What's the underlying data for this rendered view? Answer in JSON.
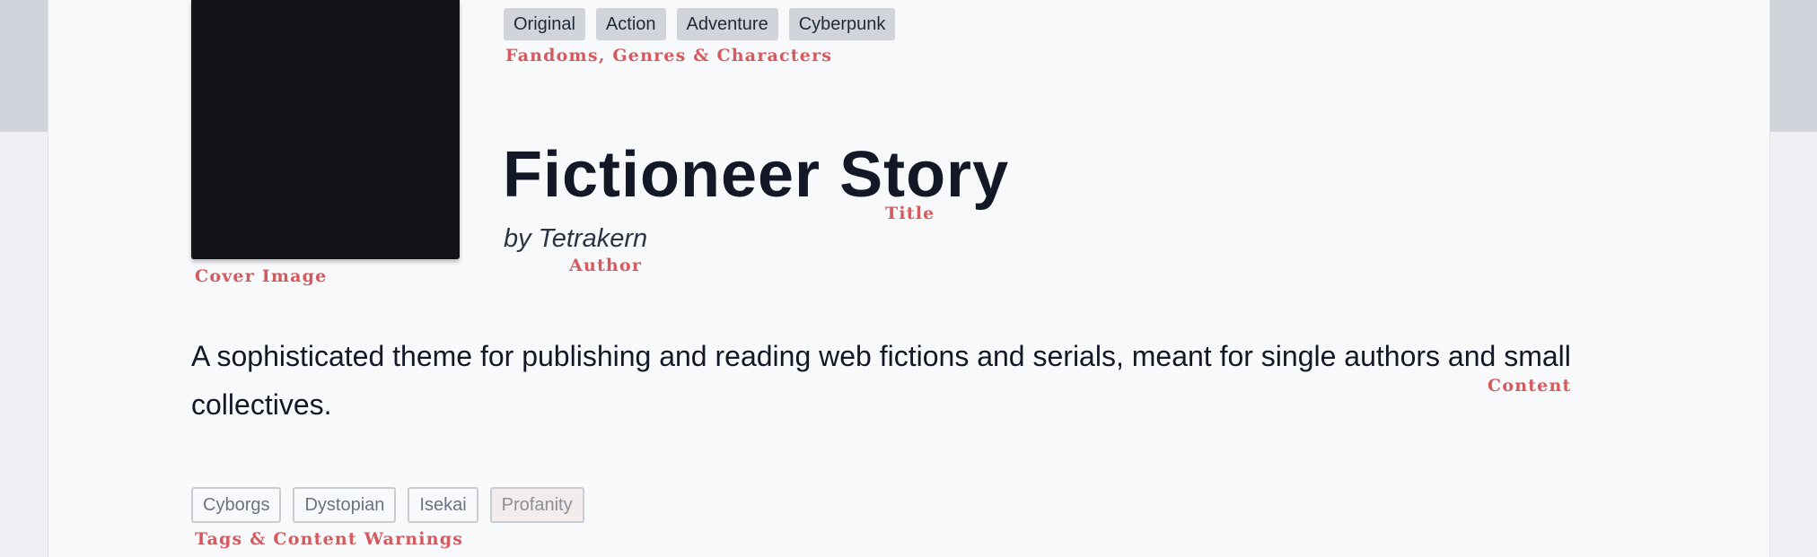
{
  "genre_tags": [
    "Original",
    "Action",
    "Adventure",
    "Cyberpunk"
  ],
  "story": {
    "title": "Fictioneer Story",
    "author": "by Tetrakern",
    "content": "A sophisticated theme for publishing and reading web fictions and serials, meant for single authors and small collectives."
  },
  "tags": [
    "Cyborgs",
    "Dystopian",
    "Isekai"
  ],
  "content_warnings": [
    "Profanity"
  ],
  "annotations": {
    "fandoms": "Fandoms, Genres & Characters",
    "title": "Title",
    "author": "Author",
    "cover": "Cover Image",
    "content": "Content",
    "tags": "Tags & Content Warnings"
  },
  "colors": {
    "annotation": "#d45a5e",
    "cover": "#131418",
    "title": "#121826"
  }
}
